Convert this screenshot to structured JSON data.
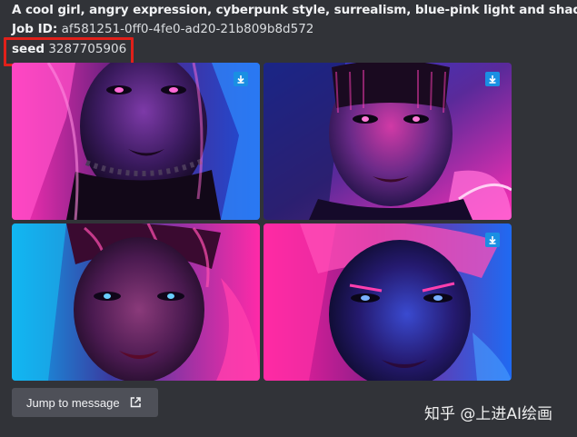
{
  "message": {
    "prompt": "A cool girl, angry expression, cyberpunk style, surrealism, blue-pink light and shadow",
    "job_id_label": "Job ID:",
    "job_id_value": "af581251-0ff0-4fe0-ad20-21b809b8d572",
    "seed_label": "seed",
    "seed_value": "3287705906"
  },
  "images": [
    {
      "name": "image-1",
      "download_icon": "download-icon"
    },
    {
      "name": "image-2",
      "download_icon": "download-icon"
    },
    {
      "name": "image-3",
      "download_icon": ""
    },
    {
      "name": "image-4",
      "download_icon": "download-icon"
    }
  ],
  "actions": {
    "jump_label": "Jump to message",
    "jump_icon": "external-link-icon"
  },
  "watermark": "知乎 @上进AI绘画",
  "colors": {
    "background": "#313338",
    "highlight_box": "#e0201a",
    "download_badge": "#1a8fe3",
    "button": "#4e5058",
    "neon_pink": "#ff1fa8",
    "neon_blue": "#2a6bff"
  }
}
